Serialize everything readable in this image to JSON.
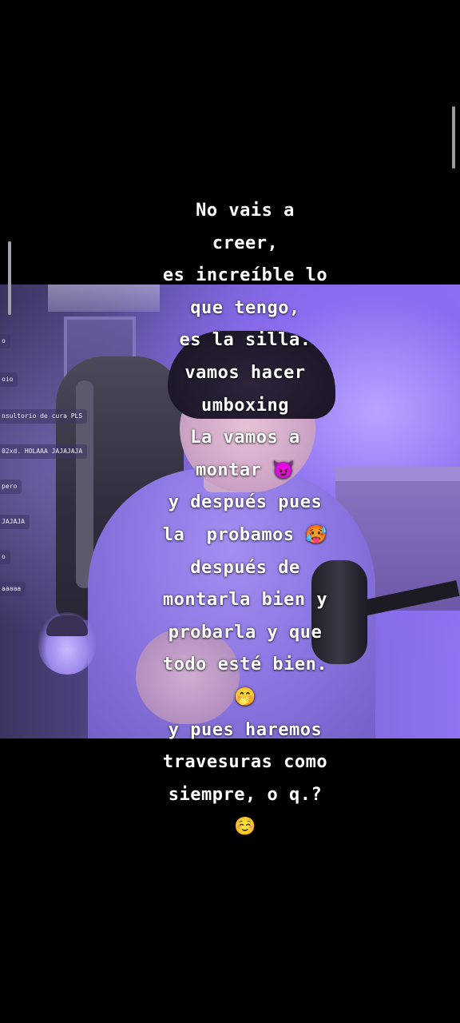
{
  "chat": {
    "messages": [
      "o",
      "oio",
      "nsultorio de cura PLS",
      "02xd. HOLAAA JAJAJAJA",
      "pero",
      "JAJAJA",
      "o",
      "aaaaa"
    ]
  },
  "caption": {
    "lines": [
      "No vais a",
      "creer,",
      "es increíble lo",
      "que tengo,",
      "es la silla.",
      "vamos hacer",
      "umboxing",
      "La vamos a",
      "montar 😈",
      "y después pues",
      "la  probamos 🥵",
      "después de",
      "montarla bien y",
      "probarla y que",
      "todo esté bien.",
      "🤭",
      "y pues haremos",
      "travesuras como",
      "siempre, o q.?",
      "☺️"
    ]
  }
}
